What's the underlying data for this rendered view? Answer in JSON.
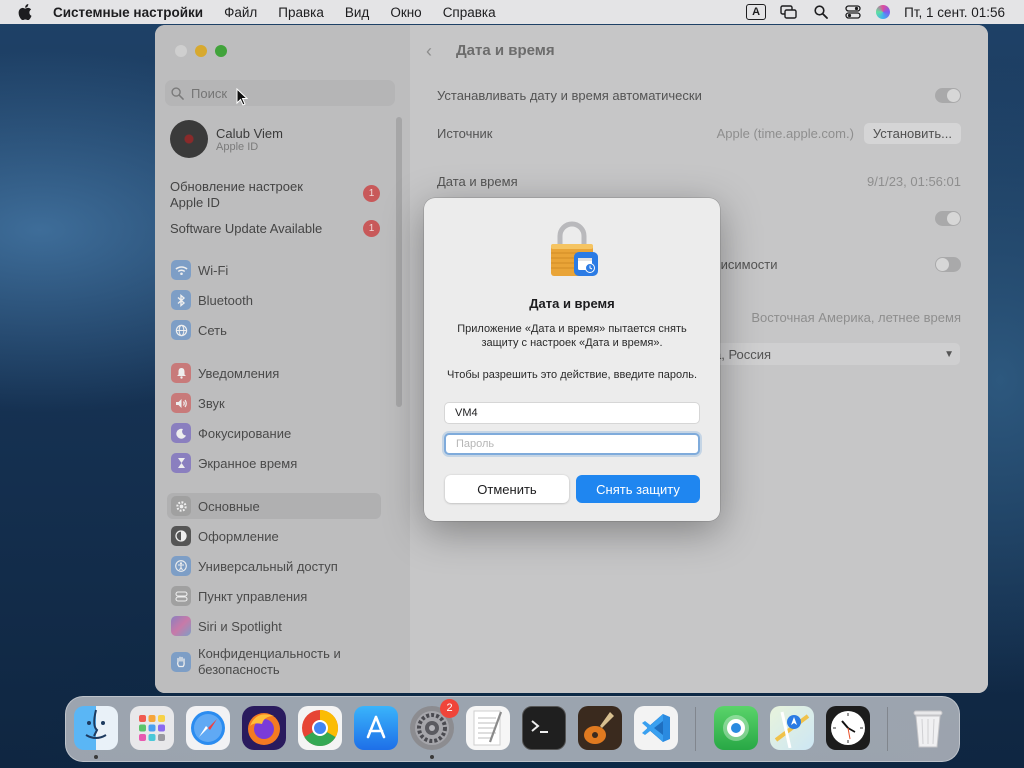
{
  "menubar": {
    "app_name": "Системные настройки",
    "items": [
      "Файл",
      "Правка",
      "Вид",
      "Окно",
      "Справка"
    ],
    "input_indicator": "A",
    "clock": "Пт, 1 сент.  01:56"
  },
  "sidebar": {
    "search_placeholder": "Поиск",
    "account": {
      "name": "Calub Viem",
      "subtitle": "Apple ID"
    },
    "notifications": [
      {
        "label": "Обновление настроек Apple ID",
        "badge": "1"
      },
      {
        "label": "Software Update Available",
        "badge": "1"
      }
    ],
    "items": [
      {
        "label": "Wi-Fi",
        "icon": "wifi-icon",
        "color": "#7d9ec6"
      },
      {
        "label": "Bluetooth",
        "icon": "bluetooth-icon",
        "color": "#7d9ec6"
      },
      {
        "label": "Сеть",
        "icon": "globe-icon",
        "color": "#7d9ec6"
      },
      {
        "label": "Уведомления",
        "icon": "bell-icon",
        "color": "#c87a7a"
      },
      {
        "label": "Звук",
        "icon": "speaker-icon",
        "color": "#c87a7a"
      },
      {
        "label": "Фокусирование",
        "icon": "moon-icon",
        "color": "#8a7fbf"
      },
      {
        "label": "Экранное время",
        "icon": "hourglass-icon",
        "color": "#8a7fbf"
      },
      {
        "label": "Основные",
        "icon": "gear-icon",
        "color": "#a0a0a0"
      },
      {
        "label": "Оформление",
        "icon": "appearance-icon",
        "color": "#555555"
      },
      {
        "label": "Универсальный доступ",
        "icon": "accessibility-icon",
        "color": "#7d9ec6"
      },
      {
        "label": "Пункт управления",
        "icon": "control-center-icon",
        "color": "#a0a0a0"
      },
      {
        "label": "Siri и Spotlight",
        "icon": "siri-icon",
        "color": "#8a7fbf"
      },
      {
        "label": "Конфиденциальность и безопасность",
        "icon": "hand-icon",
        "color": "#7d9ec6"
      }
    ]
  },
  "main": {
    "title": "Дата и время",
    "auto_label": "Устанавливать дату и время автоматически",
    "source_label": "Источник",
    "source_value": "Apple (time.apple.com.)",
    "set_button": "Установить...",
    "datetime_label": "Дата и время",
    "datetime_value": "9/1/23, 01:56:01",
    "partial_label": "в зависимости",
    "timezone_value": "Восточная Америка, летнее время",
    "city_value": "а, Россия",
    "help": "?"
  },
  "dialog": {
    "title": "Дата и время",
    "message": "Приложение «Дата и время» пытается снять защиту с настроек «Дата и время».",
    "prompt": "Чтобы разрешить это действие, введите пароль.",
    "username": "VM4",
    "password_placeholder": "Пароль",
    "cancel": "Отменить",
    "confirm": "Снять защиту"
  },
  "dock": {
    "apps": [
      "Finder",
      "Launchpad",
      "Safari",
      "Firefox",
      "Chrome",
      "App Store",
      "Системные настройки",
      "TextEdit",
      "Terminal",
      "GarageBand",
      "Visual Studio Code",
      "Find My",
      "Maps",
      "Clock",
      "Trash"
    ],
    "settings_badge": "2"
  }
}
